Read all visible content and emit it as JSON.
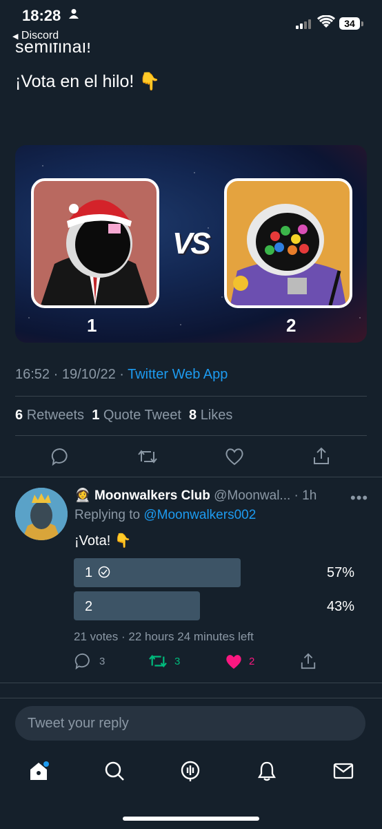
{
  "status_bar": {
    "time": "18:28",
    "back_label": "Discord",
    "battery": "34"
  },
  "tweet": {
    "text_cut": "semifinal!",
    "text": "¡Vota en el hilo! 👇",
    "media": {
      "vs_label": "VS",
      "left_number": "1",
      "right_number": "2"
    },
    "time": "16:52",
    "date": "19/10/22",
    "source_app": "Twitter Web App",
    "retweets_count": "6",
    "retweets_label": "Retweets",
    "quotes_count": "1",
    "quotes_label": "Quote Tweet",
    "likes_count": "8",
    "likes_label": "Likes"
  },
  "reply": {
    "emoji": "👩‍🚀",
    "name": "Moonwalkers Club",
    "handle": "@Moonwal...",
    "time": "1h",
    "replying_prefix": "Replying to",
    "replying_to": "@Moonwalkers002",
    "text": "¡Vota! 👇",
    "poll": [
      {
        "label": "1",
        "percent": "57%",
        "fraction": 0.57,
        "selected": true
      },
      {
        "label": "2",
        "percent": "43%",
        "fraction": 0.43,
        "selected": false
      }
    ],
    "poll_meta": "21 votes · 22 hours 24 minutes left",
    "reply_count": "3",
    "retweet_count": "3",
    "like_count": "2",
    "colors": {
      "retweet": "#00ba7c",
      "like": "#f91880"
    }
  },
  "composer": {
    "placeholder": "Tweet your reply"
  },
  "tabbar": [
    "home-icon",
    "search-icon",
    "spaces-icon",
    "notifications-icon",
    "messages-icon"
  ]
}
